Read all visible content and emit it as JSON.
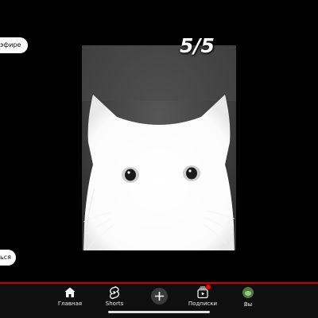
{
  "overlay": {
    "top_chip_label": "эфире",
    "bottom_chip_label": "ься"
  },
  "video": {
    "counter": "5/5"
  },
  "nav": {
    "home_label": "Главная",
    "shorts_label": "Shorts",
    "subscriptions_label": "Подписки",
    "you_label": "Вы"
  },
  "colors": {
    "background": "#000000",
    "navbar": "#0f0f0f",
    "accent_line": "#cc0000",
    "notification": "#ff0000"
  },
  "icons": {
    "home": "home-icon",
    "shorts": "shorts-icon",
    "create": "plus-icon",
    "subscriptions": "subscriptions-icon",
    "you": "avatar"
  }
}
